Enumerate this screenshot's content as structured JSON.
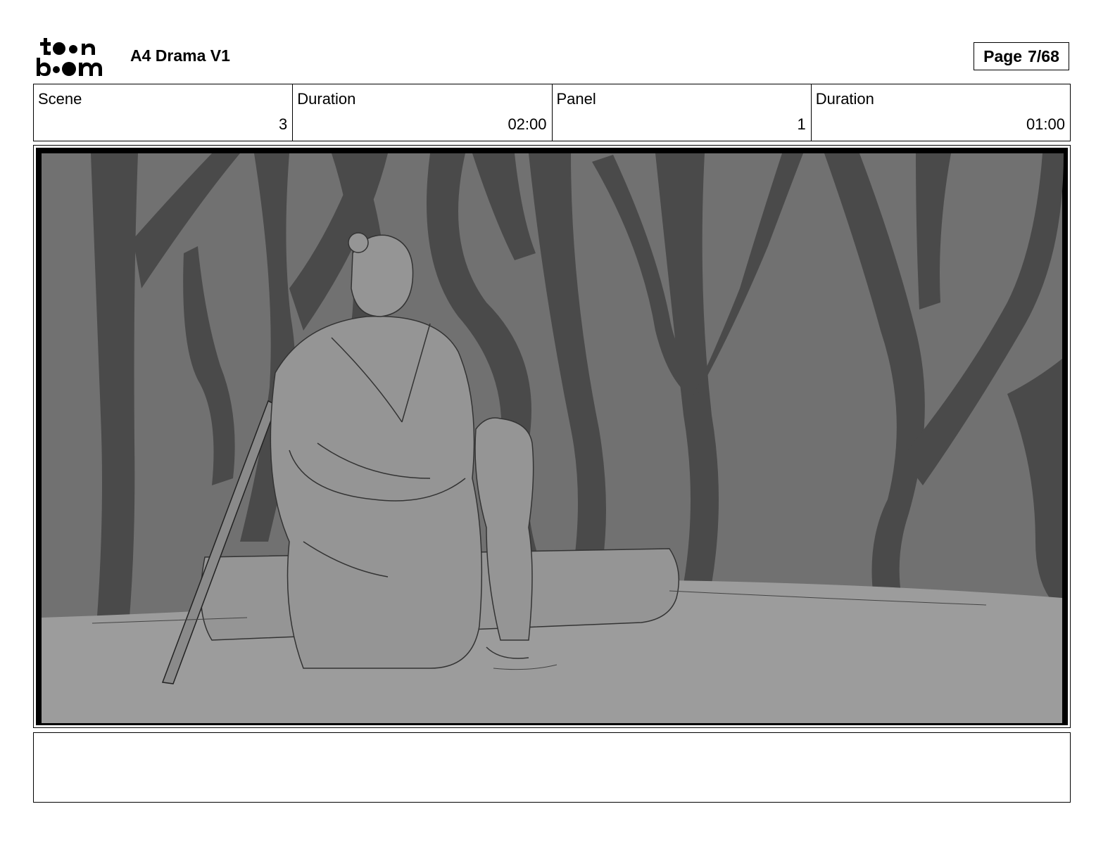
{
  "header": {
    "logo": {
      "line1": "toon",
      "line2": "boom"
    },
    "project_title": "A4 Drama V1",
    "page": {
      "label": "Page",
      "value": "7/68"
    }
  },
  "info": {
    "scene": {
      "label": "Scene",
      "value": "3"
    },
    "scene_duration": {
      "label": "Duration",
      "value": "02:00"
    },
    "panel": {
      "label": "Panel",
      "value": "1"
    },
    "panel_duration": {
      "label": "Duration",
      "value": "01:00"
    }
  },
  "panel_image": {
    "subject": "storyboard-sketch",
    "colors": {
      "background": "#717171",
      "trees": "#4a4a4a",
      "ground": "#9c9c9c",
      "figures": "#959595",
      "frame": "#000000"
    }
  },
  "notes": {
    "text": ""
  }
}
